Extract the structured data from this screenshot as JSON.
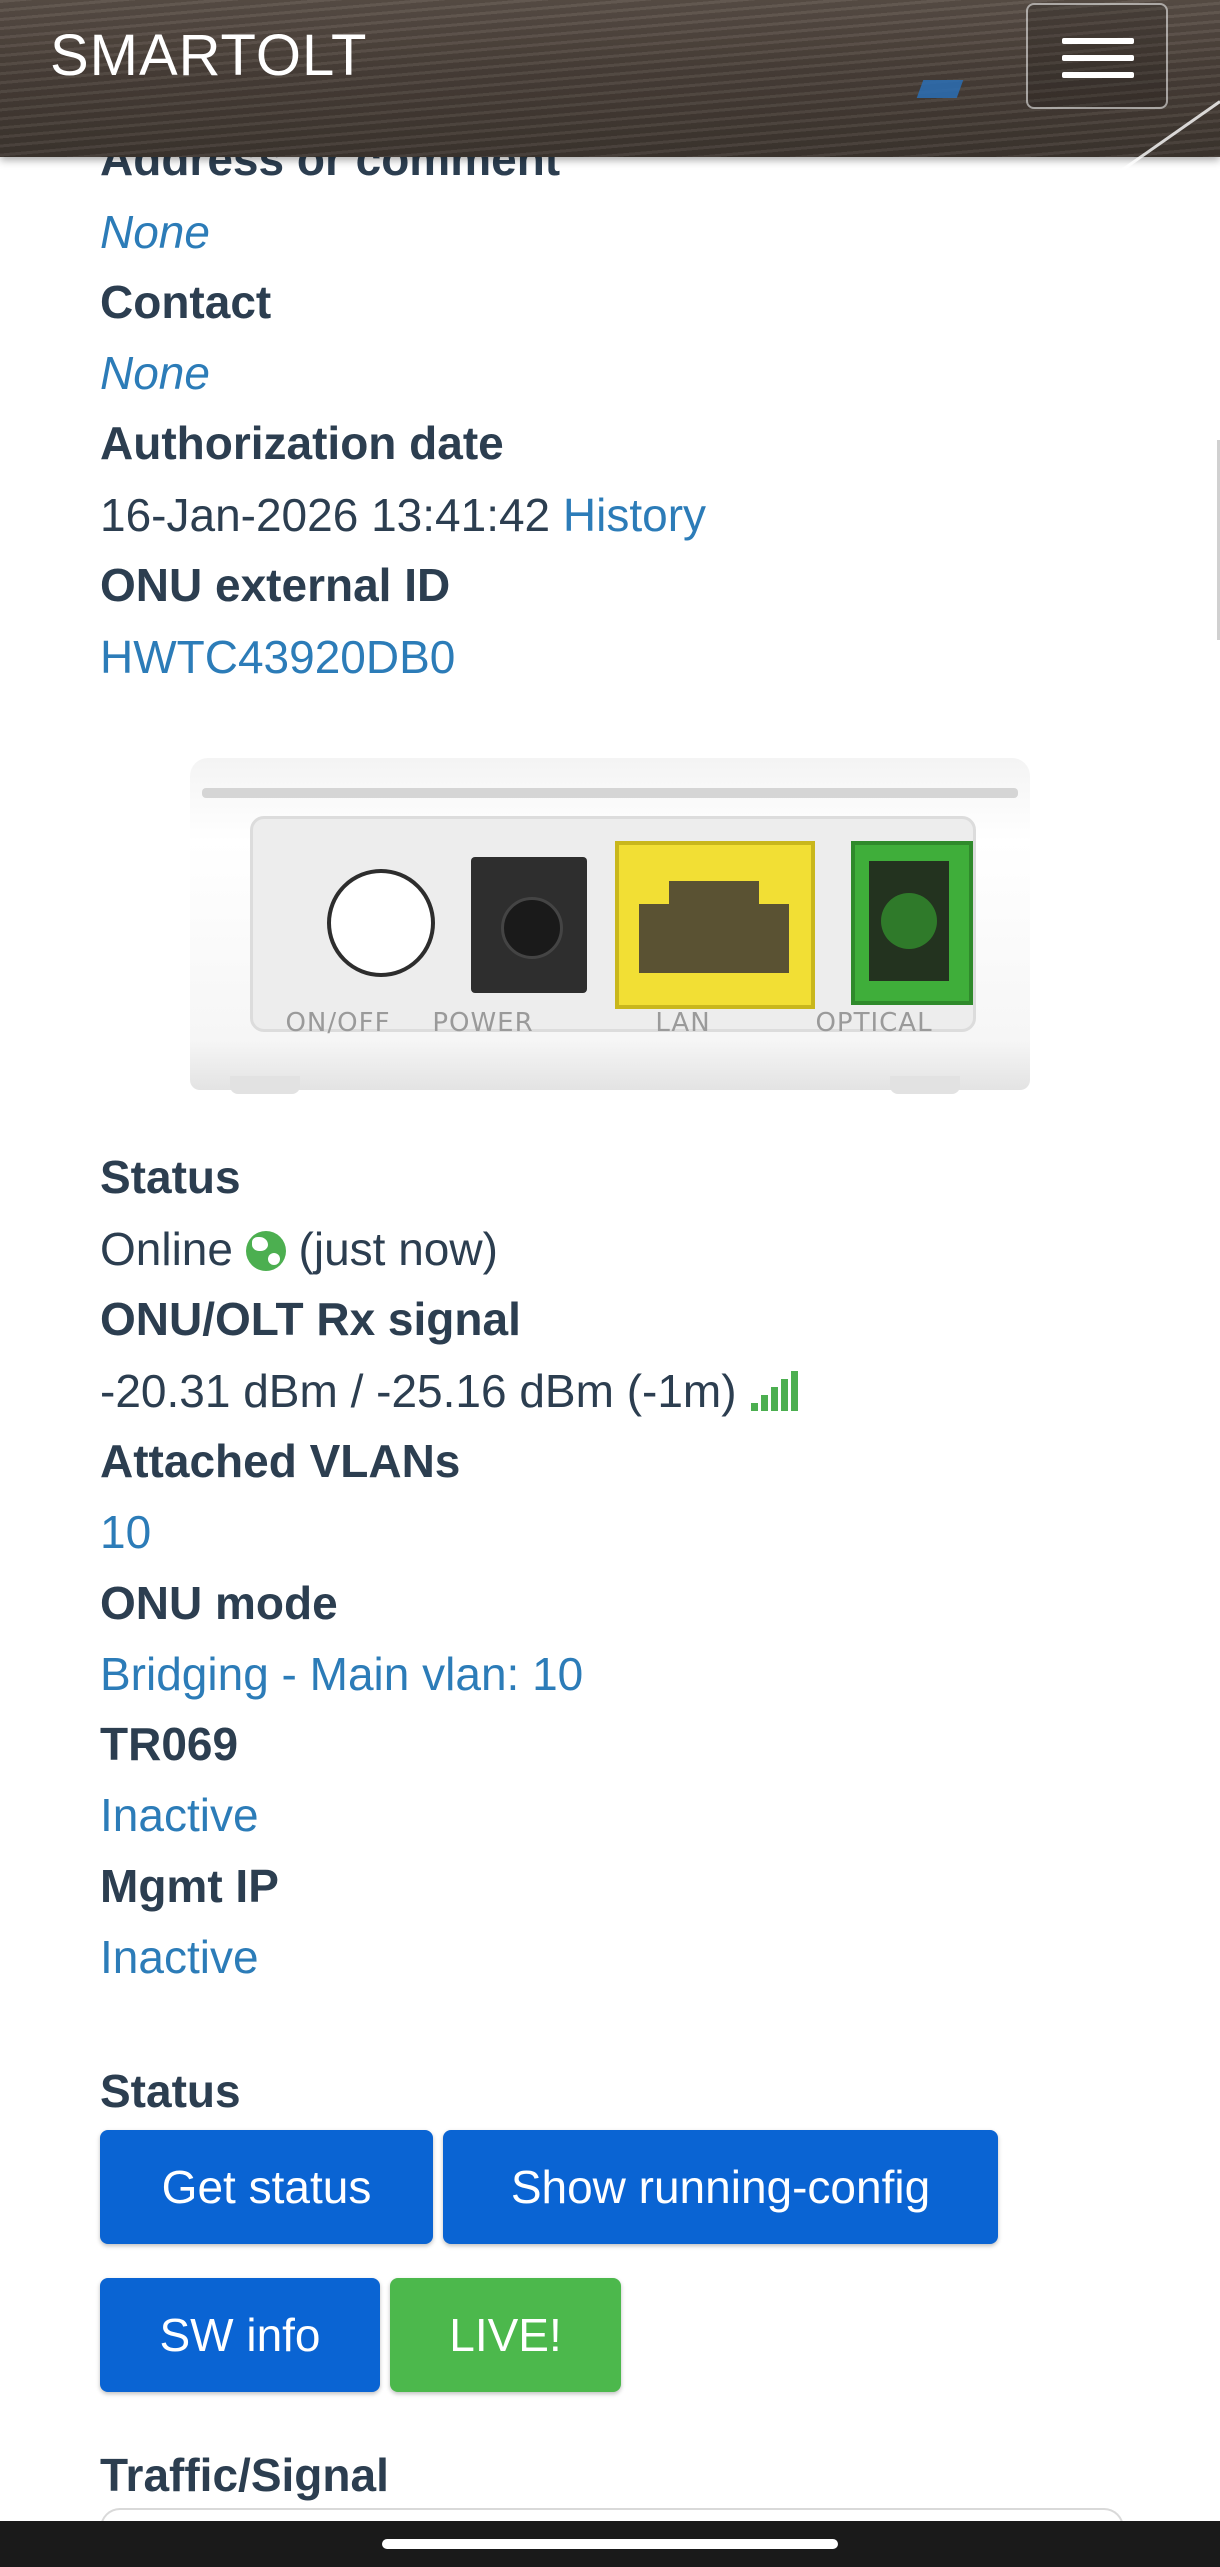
{
  "navbar": {
    "brand": "SMARTOLT",
    "menu_icon": "hamburger-menu-icon"
  },
  "details": {
    "address_label": "Address or comment",
    "address_value": "None",
    "contact_label": "Contact",
    "contact_value": "None",
    "auth_date_label": "Authorization date",
    "auth_date_value": "16-Jan-2026 13:41:42",
    "history_link": "History",
    "external_id_label": "ONU external ID",
    "external_id_value": "HWTC43920DB0"
  },
  "device": {
    "ports": [
      "ON/OFF",
      "POWER",
      "LAN",
      "OPTICAL"
    ]
  },
  "status": {
    "status_label": "Status",
    "status_value": "Online",
    "status_when": "(just now)",
    "signal_label": "ONU/OLT Rx signal",
    "signal_value": "-20.31 dBm / -25.16 dBm (-1m)",
    "signal_icon": "signal-bars-icon",
    "vlans_label": "Attached VLANs",
    "vlans_value": "10",
    "mode_label": "ONU mode",
    "mode_value": "Bridging - Main vlan: 10",
    "tr069_label": "TR069",
    "tr069_value": "Inactive",
    "mgmt_label": "Mgmt IP",
    "mgmt_value": "Inactive"
  },
  "actions": {
    "section_label": "Status",
    "get_status": "Get status",
    "show_running_config": "Show running-config",
    "sw_info": "SW info",
    "live": "LIVE!"
  },
  "traffic": {
    "section_label": "Traffic/Signal"
  },
  "colors": {
    "link": "#2c7cb8",
    "button_blue": "#0a64d3",
    "button_green": "#4cb84c",
    "online_green": "#4caf50"
  }
}
